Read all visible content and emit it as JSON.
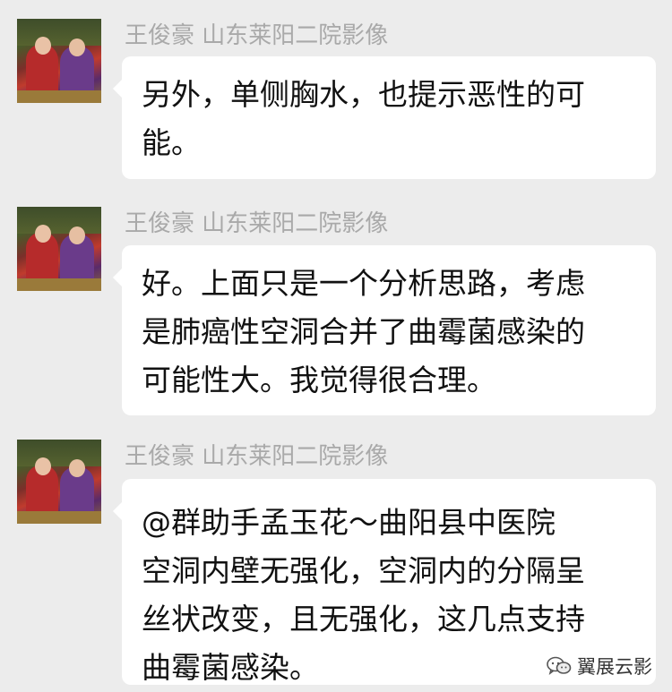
{
  "messages": [
    {
      "sender": "王俊豪 山东莱阳二院影像",
      "lines": [
        "另外，单侧胸水，也提示恶性的可",
        "能。"
      ]
    },
    {
      "sender": "王俊豪 山东莱阳二院影像",
      "lines": [
        "好。上面只是一个分析思路，考虑",
        "是肺癌性空洞合并了曲霉菌感染的",
        "可能性大。我觉得很合理。"
      ]
    },
    {
      "sender": "王俊豪 山东莱阳二院影像",
      "lines": [
        "@群助手孟玉花～曲阳县中医院",
        "空洞内壁无强化，空洞内的分隔呈",
        "丝状改变，且无强化，这几点支持",
        "曲霉菌感染。"
      ]
    }
  ],
  "watermark": {
    "icon": "wechat-icon",
    "text": "翼展云影"
  }
}
